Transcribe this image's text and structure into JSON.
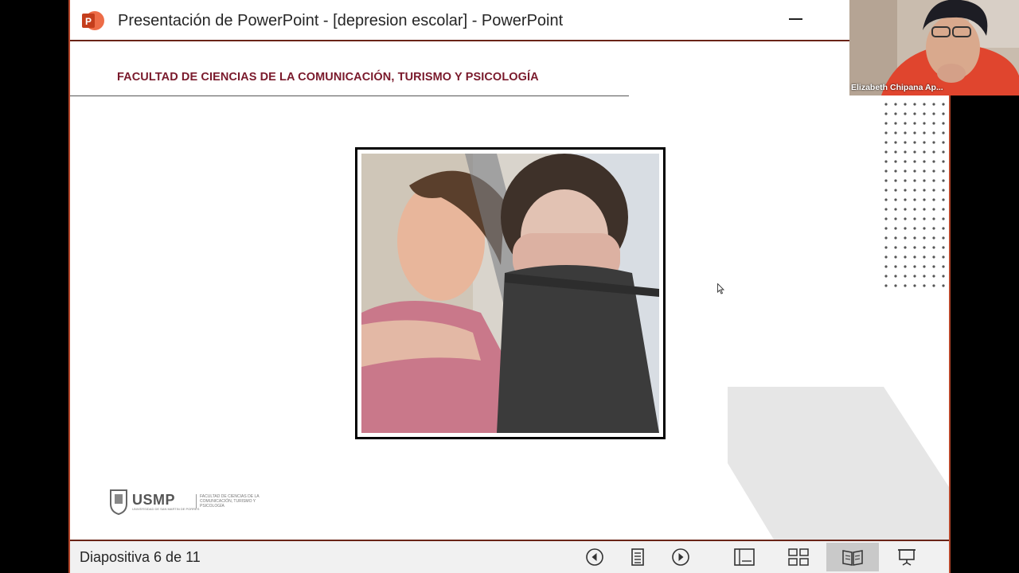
{
  "window": {
    "title": "Presentación de PowerPoint - [depresion escolar] - PowerPoint",
    "app_icon": "powerpoint-icon",
    "accent_color": "#b7472a"
  },
  "slide": {
    "heading": "FACULTAD DE CIENCIAS DE LA COMUNICACIÓN, TURISMO Y PSICOLOGÍA",
    "heading_color": "#7a1a2c",
    "logo": {
      "name": "USMP",
      "subtitle": "UNIVERSIDAD DE SAN MARTIN DE PORRES",
      "faculty": "FACULTAD DE CIENCIAS DE LA COMUNICACIÓN, TURISMO Y PSICOLOGÍA"
    }
  },
  "statusbar": {
    "slide_counter": "Diapositiva 6 de 11",
    "buttons": [
      "previous-icon",
      "slide-menu-icon",
      "next-icon",
      "normal-view-icon",
      "slide-sorter-icon",
      "reading-view-icon",
      "slideshow-icon"
    ]
  },
  "video": {
    "participant_name": "Elizabeth Chipana Ap..."
  }
}
